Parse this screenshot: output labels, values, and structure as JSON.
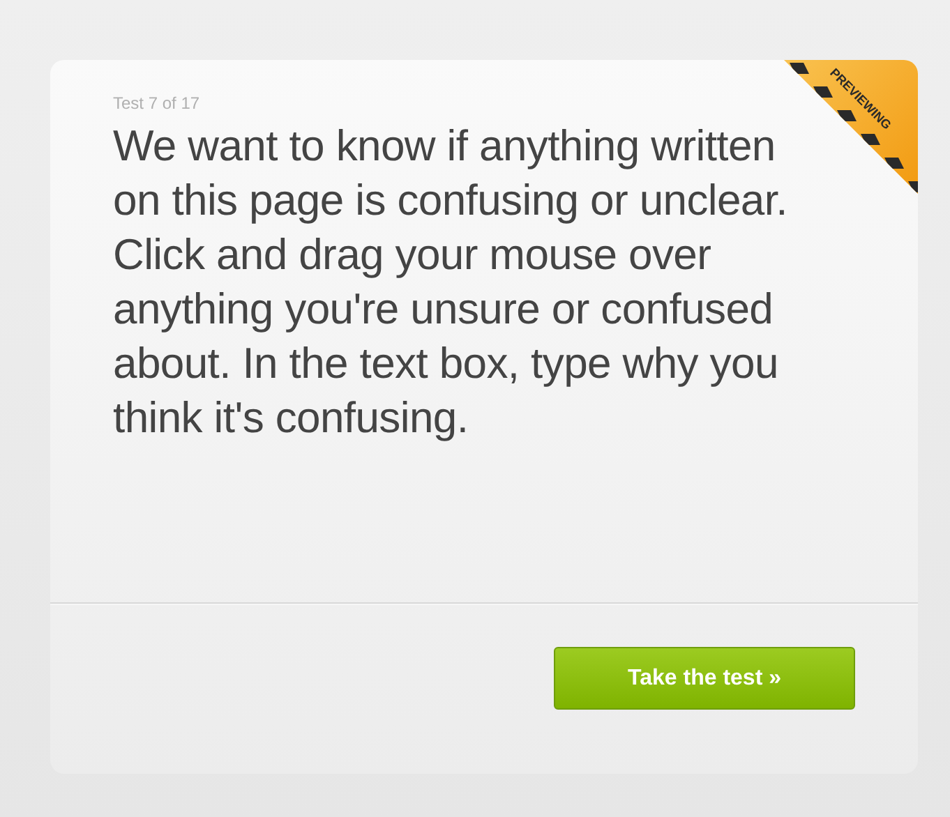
{
  "card": {
    "counter": "Test 7 of 17",
    "instructions": "We want to know if anything written on this page is confusing or unclear. Click and drag your mouse over anything you're unsure or confused about. In the text box, type why you think it's confusing.",
    "ribbon": "PREVIEWING",
    "button": "Take the test »"
  }
}
